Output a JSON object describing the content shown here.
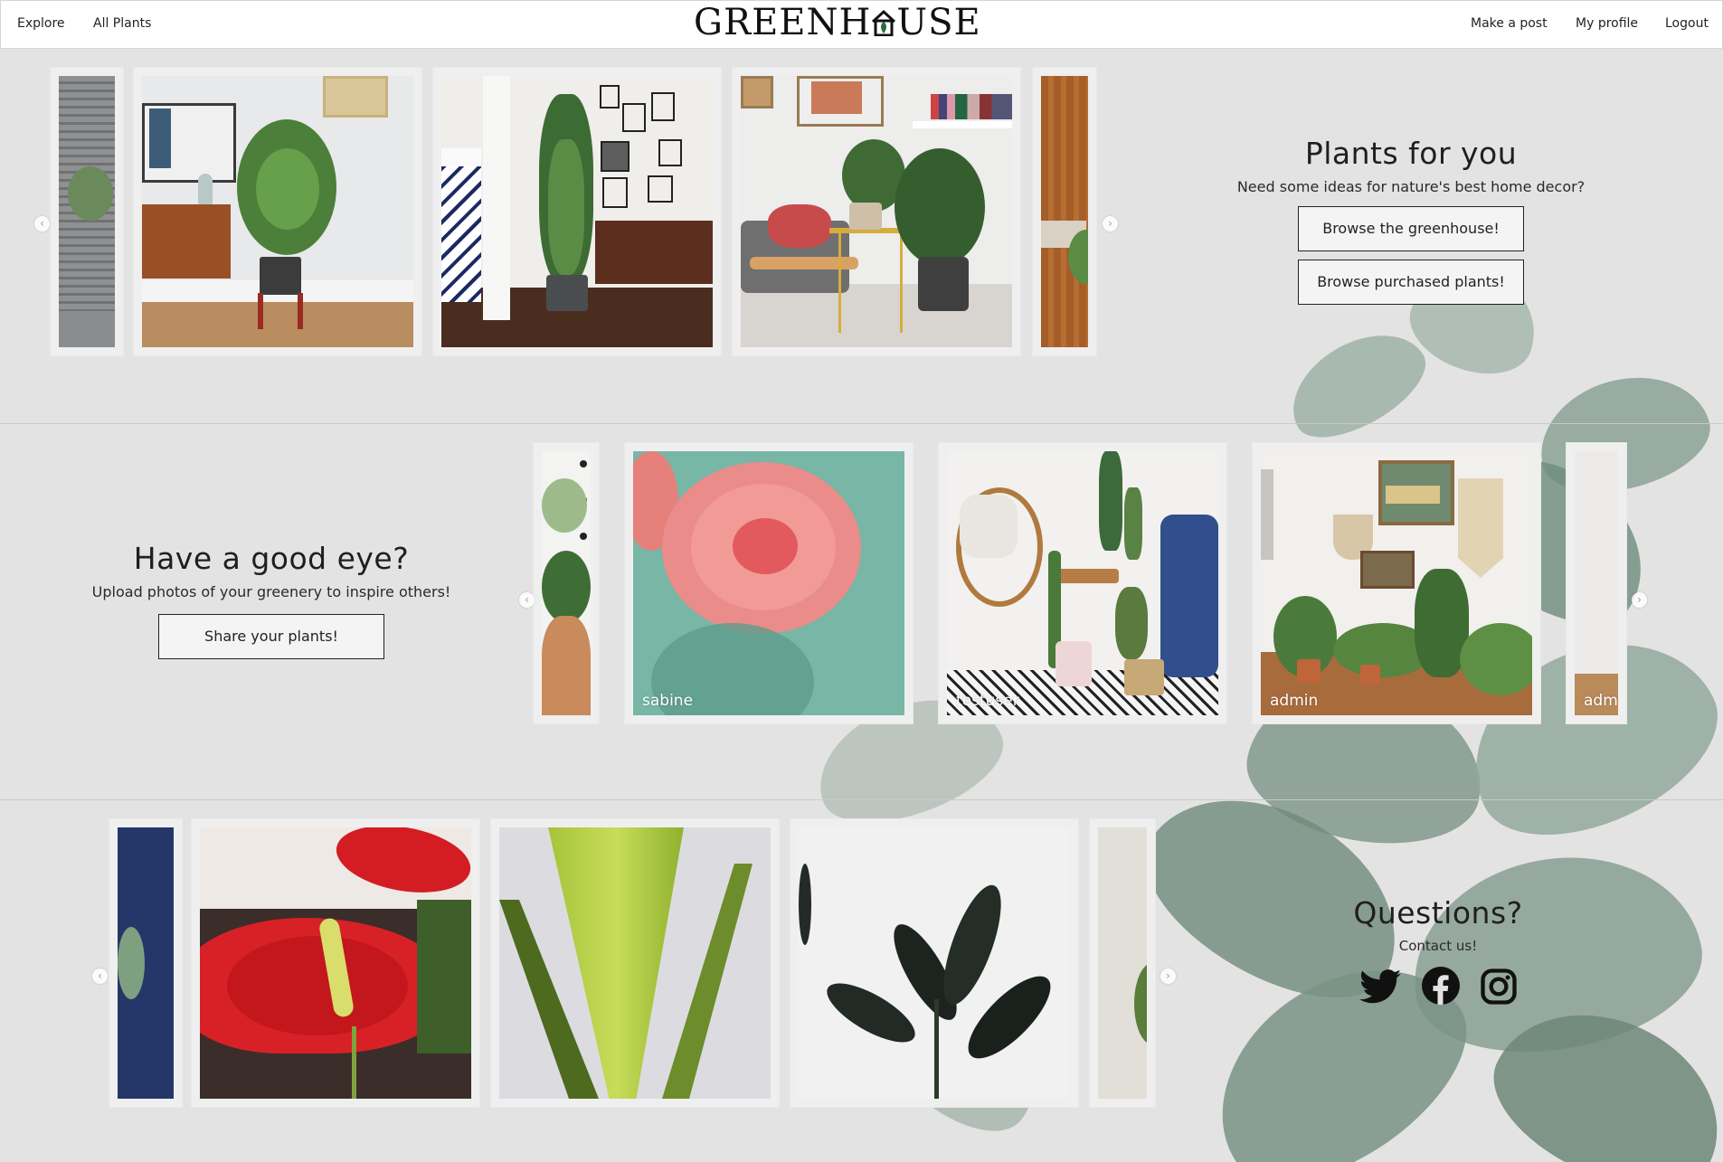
{
  "nav": {
    "explore": "Explore",
    "all_plants": "All Plants",
    "logo_left": "GREENH",
    "logo_right": "USE",
    "make_post": "Make a post",
    "my_profile": "My profile",
    "logout": "Logout"
  },
  "plants_for_you": {
    "title": "Plants for you",
    "subtitle": "Need some ideas for nature's best home decor?",
    "browse_button": "Browse the greenhouse!",
    "purchased_button": "Browse purchased plants!"
  },
  "good_eye": {
    "title": "Have a good eye?",
    "subtitle": "Upload photos of your greenery to inspire others!",
    "share_button": "Share your plants!",
    "posts": [
      {
        "user": "sabine"
      },
      {
        "user": "testuser"
      },
      {
        "user": "admin"
      },
      {
        "user": "admin"
      }
    ]
  },
  "questions": {
    "title": "Questions?",
    "subtitle": "Contact us!",
    "icons": [
      "twitter-icon",
      "facebook-icon",
      "instagram-icon"
    ]
  },
  "colors": {
    "background": "#e4e3e3",
    "card": "#efefef",
    "text": "#1e1e1e",
    "logo_green": "#2f6b3a"
  }
}
